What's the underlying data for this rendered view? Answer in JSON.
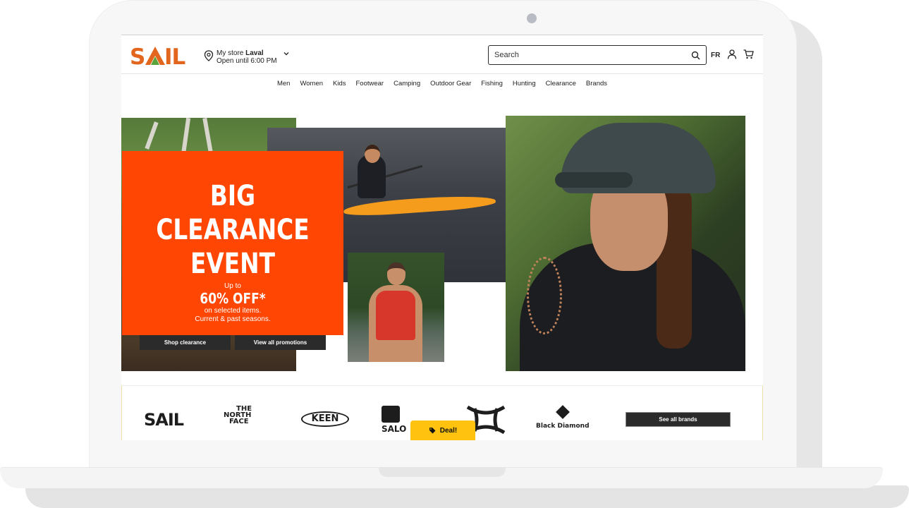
{
  "header": {
    "logo_text": "SAIL",
    "store_prefix": "My store",
    "store_name": "Laval",
    "store_hours": "Open until 6:00 PM",
    "search_placeholder": "Search",
    "lang": "FR"
  },
  "nav": {
    "items": [
      "Men",
      "Women",
      "Kids",
      "Footwear",
      "Camping",
      "Outdoor Gear",
      "Fishing",
      "Hunting",
      "Clearance",
      "Brands"
    ]
  },
  "promo": {
    "title_line1": "BIG CLEARANCE",
    "title_line2": "EVENT",
    "up_to": "Up to",
    "discount": "60% OFF*",
    "sub_line1": "on selected items.",
    "sub_line2": "Current & past seasons.",
    "btn_shop": "Shop clearance",
    "btn_promos": "View all promotions"
  },
  "brands": {
    "logos": {
      "sail": "SAIL",
      "tnf_line1": "THE",
      "tnf_line2": "NORTH",
      "tnf_line3": "FACE",
      "keen": "KEEN",
      "salomon": "SALO",
      "black_diamond": "Black Diamond"
    },
    "see_all": "See all brands"
  },
  "deal": {
    "label": "Deal!"
  },
  "colors": {
    "promo_orange": "#ff4602",
    "deal_yellow": "#ffc20e",
    "logo_orange": "#e2661e",
    "logo_green": "#5aa23a"
  }
}
